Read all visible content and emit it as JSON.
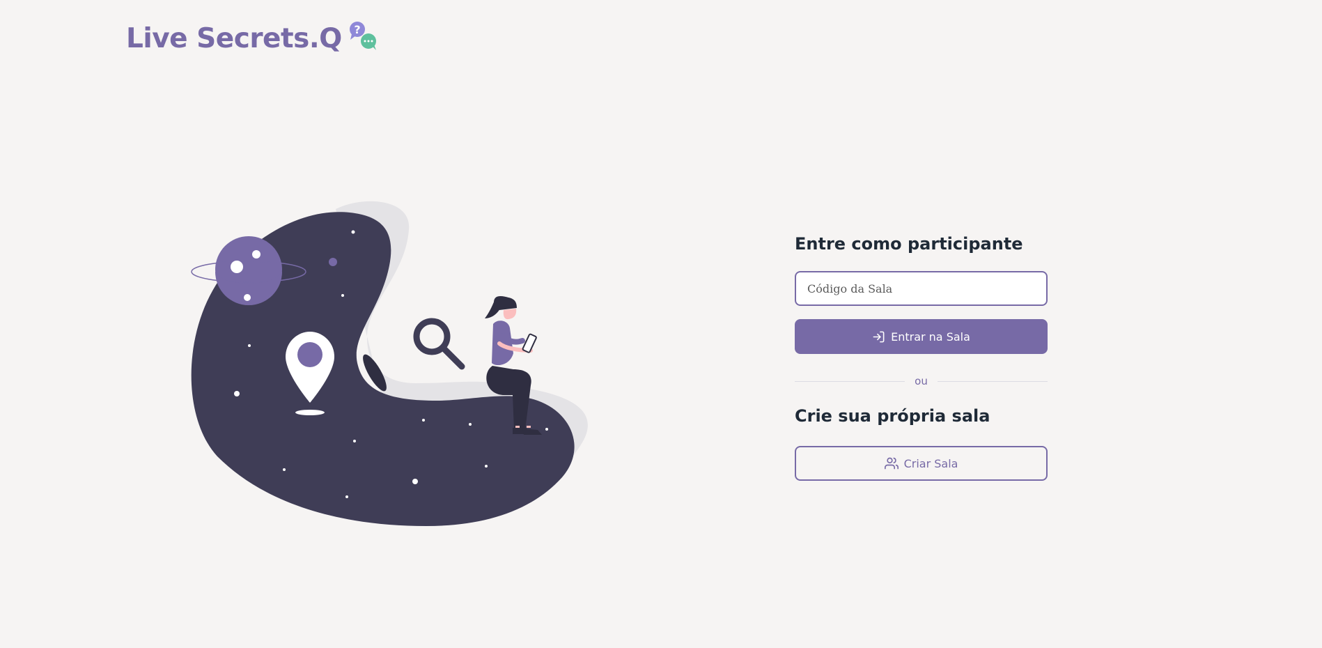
{
  "brand": {
    "name": "Live Secrets.Q",
    "accent_color": "#776aa6",
    "icon": "question-chat-bubbles-icon",
    "icon_text": "?"
  },
  "illustration": {
    "name": "woman-sitting-on-space-blob-illustration"
  },
  "join": {
    "heading": "Entre como participante",
    "code_placeholder": "Código da Sala",
    "code_value": "",
    "enter_button_label": "Entrar na Sala",
    "enter_button_icon": "log-in-icon"
  },
  "divider": {
    "text": "ou"
  },
  "create": {
    "heading": "Crie sua própria sala",
    "create_button_label": "Criar Sala",
    "create_button_icon": "users-icon"
  }
}
